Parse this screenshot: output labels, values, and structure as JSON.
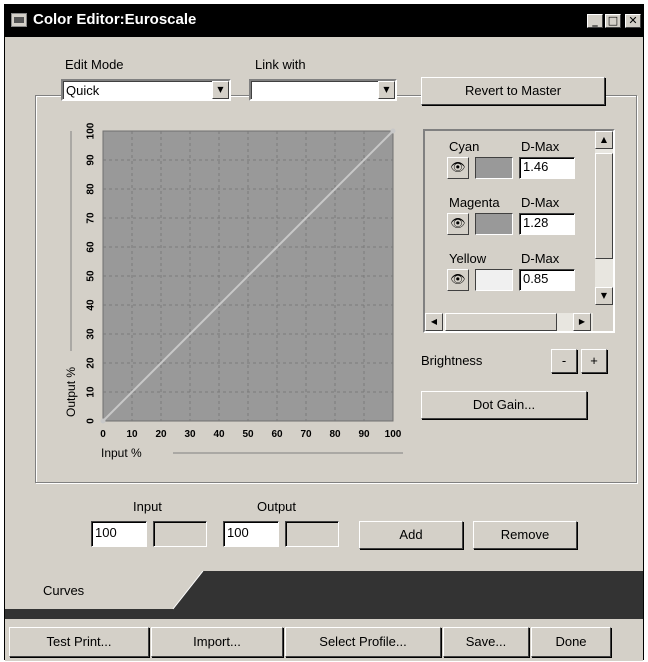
{
  "window": {
    "title": "Color Editor:Euroscale"
  },
  "title_buttons": {
    "minimize": "_",
    "maximize": "□",
    "close": "✕"
  },
  "edit_mode": {
    "label": "Edit Mode",
    "value": "Quick"
  },
  "link_with": {
    "label": "Link with",
    "value": ""
  },
  "revert_button": "Revert to Master",
  "curve": {
    "xlabel": "Input %",
    "ylabel": "Output %",
    "x_ticks": [
      "0",
      "10",
      "20",
      "30",
      "40",
      "50",
      "60",
      "70",
      "80",
      "90",
      "100"
    ],
    "y_ticks": [
      "0",
      "10",
      "20",
      "30",
      "40",
      "50",
      "60",
      "70",
      "80",
      "90",
      "100"
    ],
    "points": [
      [
        0,
        0
      ],
      [
        100,
        100
      ]
    ],
    "colors": {
      "plot_bg": "#999999",
      "grid": "#7a7a7a",
      "line": "#c8c8c8"
    }
  },
  "channels": [
    {
      "name": "Cyan",
      "dmax_label": "D-Max",
      "dmax": "1.46",
      "swatch_color": "#999999",
      "icon": "eye-icon"
    },
    {
      "name": "Magenta",
      "dmax_label": "D-Max",
      "dmax": "1.28",
      "swatch_color": "#999999",
      "icon": "eye-icon"
    },
    {
      "name": "Yellow",
      "dmax_label": "D-Max",
      "dmax": "0.85",
      "swatch_color": "#f0f0f0",
      "icon": "eye-icon"
    }
  ],
  "brightness": {
    "label": "Brightness",
    "minus": "-",
    "plus": "+"
  },
  "dot_gain_button": "Dot Gain...",
  "io": {
    "input_label": "Input",
    "output_label": "Output",
    "input_value": "100",
    "output_value": "100"
  },
  "add_button": "Add",
  "remove_button": "Remove",
  "tabs": [
    {
      "label": "Curves"
    }
  ],
  "bottom_buttons": [
    "Test Print...",
    "Import...",
    "Select Profile...",
    "Save...",
    "Done"
  ]
}
